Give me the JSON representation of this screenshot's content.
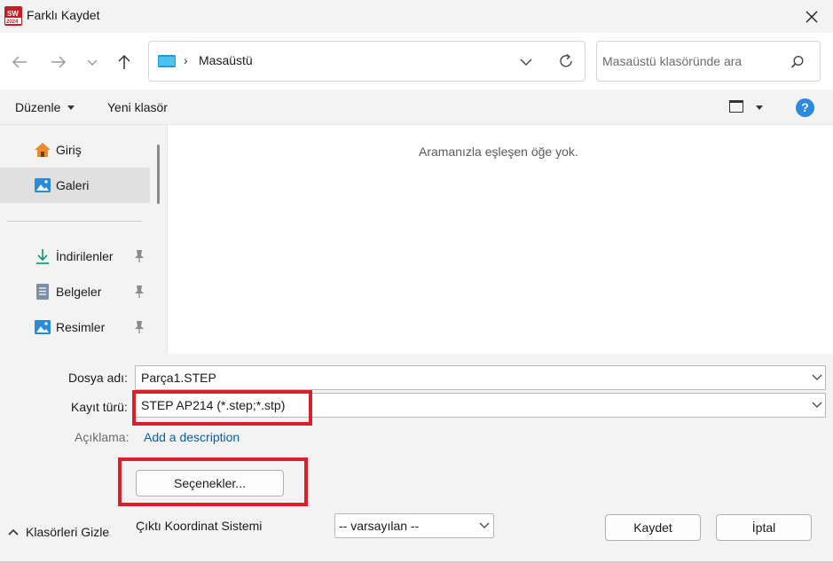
{
  "window": {
    "title": "Farklı Kaydet",
    "app_icon": "solidworks-2024-icon"
  },
  "nav": {
    "breadcrumb": "Masaüstü",
    "search_placeholder": "Masaüstü klasöründe ara"
  },
  "toolbar": {
    "organize": "Düzenle",
    "new_folder": "Yeni klasör"
  },
  "sidebar": {
    "items": [
      {
        "label": "Giriş",
        "icon": "home-icon"
      },
      {
        "label": "Galeri",
        "icon": "gallery-icon",
        "selected": true
      },
      {
        "label": "İndirilenler",
        "icon": "download-icon",
        "pinned": true
      },
      {
        "label": "Belgeler",
        "icon": "documents-icon",
        "pinned": true
      },
      {
        "label": "Resimler",
        "icon": "pictures-icon",
        "pinned": true
      }
    ]
  },
  "filepane": {
    "empty_message": "Aramanızla eşleşen öğe yok."
  },
  "form": {
    "filename_label": "Dosya adı:",
    "filename_value": "Parça1.STEP",
    "filetype_label": "Kayıt türü:",
    "filetype_value": "STEP AP214 (*.step;*.stp)",
    "description_label": "Açıklama:",
    "description_link": "Add a description",
    "options_button": "Seçenekler...",
    "coord_label": "Çıktı Koordinat Sistemi",
    "coord_value": "-- varsayılan --"
  },
  "footer": {
    "hide_folders": "Klasörleri Gizle",
    "save": "Kaydet",
    "cancel": "İptal"
  },
  "colors": {
    "highlight": "#d9202a",
    "accent": "#2a8ae0",
    "link": "#0b5ea8"
  }
}
